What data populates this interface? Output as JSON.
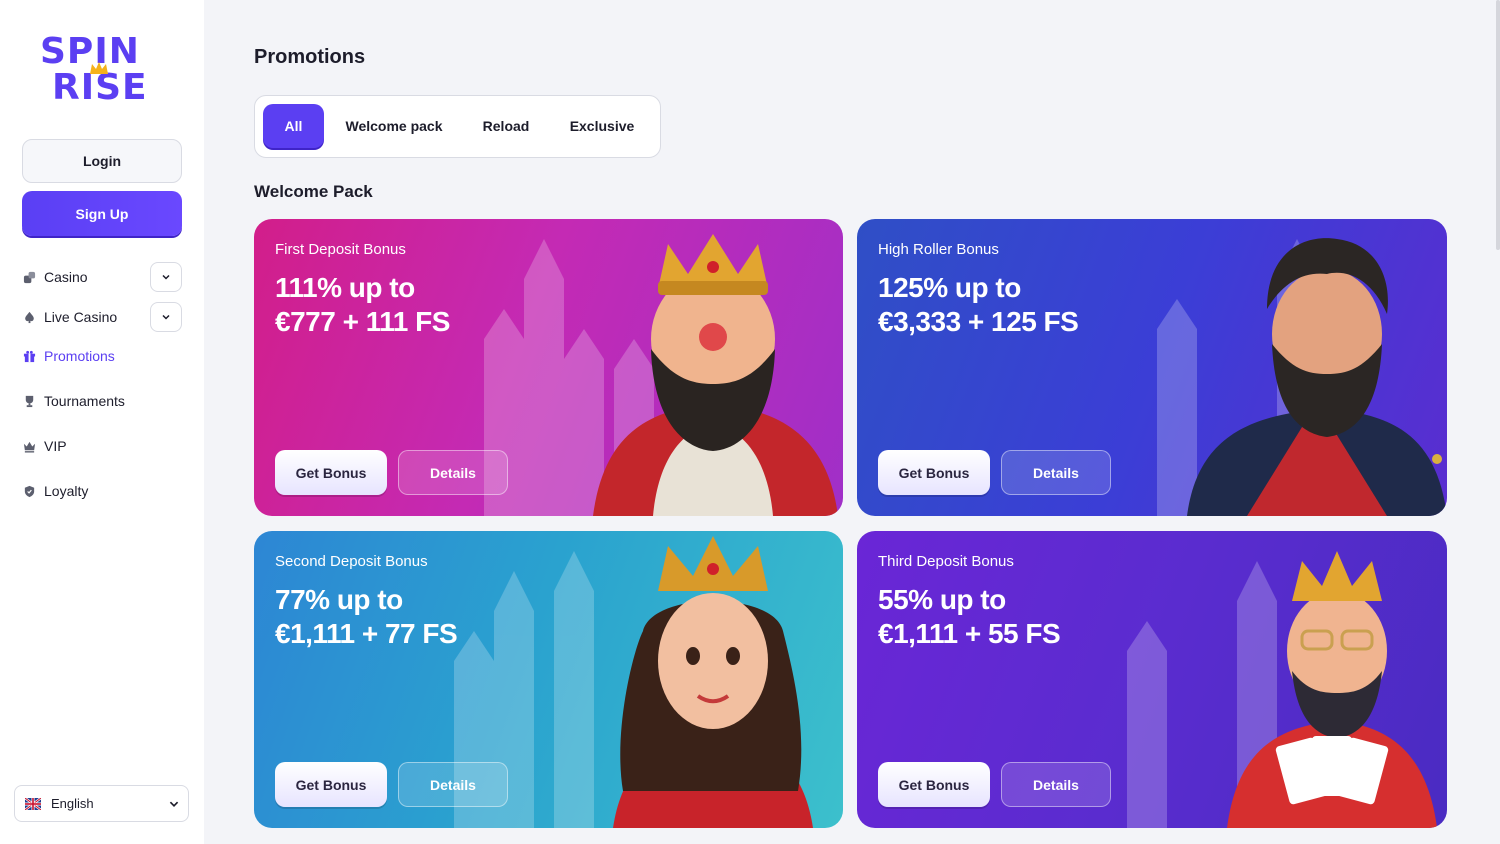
{
  "brand": {
    "line1": "SPIN",
    "line2": "RISE"
  },
  "auth": {
    "login_label": "Login",
    "signup_label": "Sign Up"
  },
  "nav": {
    "items": [
      {
        "label": "Casino",
        "icon": "dice-icon",
        "expandable": true
      },
      {
        "label": "Live Casino",
        "icon": "spade-icon",
        "expandable": true
      },
      {
        "label": "Promotions",
        "icon": "gift-icon",
        "active": true
      },
      {
        "label": "Tournaments",
        "icon": "trophy-icon"
      },
      {
        "label": "VIP",
        "icon": "crown-icon"
      },
      {
        "label": "Loyalty",
        "icon": "shield-icon"
      }
    ]
  },
  "language": {
    "selected": "English",
    "icon": "uk-flag-icon"
  },
  "page": {
    "title": "Promotions"
  },
  "tabs": [
    {
      "label": "All",
      "active": true
    },
    {
      "label": "Welcome pack"
    },
    {
      "label": "Reload"
    },
    {
      "label": "Exclusive"
    }
  ],
  "section": {
    "title": "Welcome Pack"
  },
  "cards": [
    {
      "label": "First Deposit Bonus",
      "line1": "111% up to",
      "line2": "€777 + 111 FS",
      "get_label": "Get Bonus",
      "details_label": "Details",
      "color": "#d21e8a"
    },
    {
      "label": "High Roller Bonus",
      "line1": "125% up to",
      "line2": "€3,333 + 125 FS",
      "get_label": "Get Bonus",
      "details_label": "Details",
      "color": "#2f4fc6"
    },
    {
      "label": "Second Deposit Bonus",
      "line1": "77% up to",
      "line2": "€1,111 + 77 FS",
      "get_label": "Get Bonus",
      "details_label": "Details",
      "color": "#2aa2cf"
    },
    {
      "label": "Third Deposit Bonus",
      "line1": "55% up to",
      "line2": "€1,111 + 55 FS",
      "get_label": "Get Bonus",
      "details_label": "Details",
      "color": "#6a26d6"
    }
  ],
  "colors": {
    "accent": "#5b3ff2",
    "background": "#f3f4f8"
  }
}
